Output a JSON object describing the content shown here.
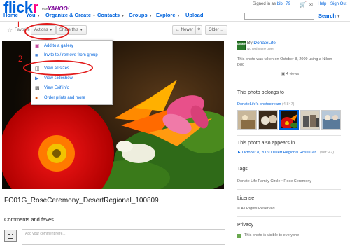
{
  "header": {
    "logo_part1": "flick",
    "logo_part2": "r",
    "logo_from": "from",
    "logo_yahoo": "YAHOO!",
    "signed_in_prefix": "Signed in as",
    "username": "bibi_79",
    "help": "Help",
    "sign_out": "Sign Out"
  },
  "nav": {
    "items": [
      {
        "label": "Home"
      },
      {
        "label": "You"
      },
      {
        "label": "Organize & Create"
      },
      {
        "label": "Contacts"
      },
      {
        "label": "Groups"
      },
      {
        "label": "Explore"
      },
      {
        "label": "Upload"
      }
    ],
    "search_label": "Search",
    "search_value": ""
  },
  "toolbar": {
    "favorite": "Favorite",
    "actions": "Actions",
    "share": "Share this",
    "newer": "Newer",
    "older": "Older"
  },
  "annotations": {
    "step1": "1",
    "step2": "2",
    "color": "#e21b1b"
  },
  "actions_menu": {
    "items": [
      {
        "label": "Add to a gallery",
        "icon": "gallery-icon"
      },
      {
        "label": "Invite to / remove from group",
        "icon": "group-icon"
      },
      {
        "label": "View all sizes",
        "icon": "sizes-icon"
      },
      {
        "label": "View slideshow",
        "icon": "slideshow-icon"
      },
      {
        "label": "View Exif info",
        "icon": "exif-icon"
      },
      {
        "label": "Order prints and more",
        "icon": "prints-icon"
      }
    ]
  },
  "photo": {
    "title": "FC01G_RoseCeremony_DesertRegional_100809"
  },
  "comments": {
    "heading": "Comments and faves",
    "placeholder": "Add your comment here..."
  },
  "sidebar": {
    "owner_icon_text": "Donate LIFE",
    "owner_by": "By",
    "owner_name": "DonateLife",
    "owner_real_name": "No real name given",
    "taken": "This photo was taken on October 8, 2009 using a Nikon D80",
    "views": "4 views",
    "belongs_heading": "This photo belongs to",
    "photostream": "DonateLife's photostream",
    "photostream_count": "(4,847)",
    "appears_heading": "This photo also appears in",
    "pool_label": "October 8, 2009 Desert Regional Rose Cer...",
    "pool_count": "(set: 47)",
    "tags_heading": "Tags",
    "tags": "Donate Life Family Circle  •  Rose Ceremony",
    "license_heading": "License",
    "license_text": "All Rights Reserved",
    "privacy_heading": "Privacy",
    "privacy_text": "This photo is visible to everyone"
  },
  "colors": {
    "link": "#0063dc",
    "flickr_pink": "#ff0084"
  }
}
